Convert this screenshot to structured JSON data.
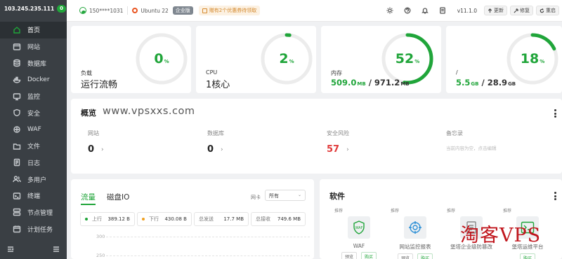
{
  "sidebar": {
    "ip": "103.245.235.111",
    "badge": "0",
    "items": [
      {
        "label": "首页",
        "icon": "home-icon"
      },
      {
        "label": "网站",
        "icon": "website-icon"
      },
      {
        "label": "数据库",
        "icon": "database-icon"
      },
      {
        "label": "Docker",
        "icon": "docker-icon"
      },
      {
        "label": "监控",
        "icon": "monitor-icon"
      },
      {
        "label": "安全",
        "icon": "shield-icon"
      },
      {
        "label": "WAF",
        "icon": "waf-icon"
      },
      {
        "label": "文件",
        "icon": "folder-icon"
      },
      {
        "label": "日志",
        "icon": "log-icon"
      },
      {
        "label": "多用户",
        "icon": "users-icon"
      },
      {
        "label": "终端",
        "icon": "terminal-icon"
      },
      {
        "label": "节点管理",
        "icon": "node-icon"
      },
      {
        "label": "计划任务",
        "icon": "calendar-icon"
      }
    ]
  },
  "topbar": {
    "user": "150****1031",
    "os": "Ubuntu 22",
    "edition": "企业版",
    "promo": "赠有2个优惠券待领取",
    "version": "v11.1.0",
    "update_label": "更新",
    "repair_label": "修复",
    "restart_label": "重启"
  },
  "stats": {
    "load": {
      "percent": "0",
      "unit": "%",
      "label": "负载",
      "status": "运行流畅",
      "fraction": 0.0
    },
    "cpu": {
      "percent": "2",
      "unit": "%",
      "label": "CPU",
      "cores": "1核心",
      "fraction": 0.02
    },
    "memory": {
      "percent": "52",
      "unit": "%",
      "label": "内存",
      "used": "509.0",
      "used_unit": "MB",
      "sep": " / ",
      "total": "971.2",
      "total_unit": "MB",
      "fraction": 0.52
    },
    "disk": {
      "percent": "18",
      "unit": "%",
      "label": "/",
      "used": "5.5",
      "used_unit": "GB",
      "sep": " / ",
      "total": "28.9",
      "total_unit": "GB",
      "fraction": 0.18
    }
  },
  "overview": {
    "title": "概览",
    "watermark": "www.vpsxxs.com",
    "items": [
      {
        "label": "网站",
        "value": "0"
      },
      {
        "label": "数据库",
        "value": "0"
      },
      {
        "label": "安全风险",
        "value": "57"
      },
      {
        "label": "备忘录",
        "value": "当前内容为空，点击编辑"
      }
    ]
  },
  "traffic": {
    "tabs": [
      "流量",
      "磁盘IO"
    ],
    "nic_label": "网卡",
    "nic_value": "所有",
    "stats": [
      {
        "label": "上行",
        "value": "389.12 B",
        "color": "#20a53a"
      },
      {
        "label": "下行",
        "value": "430.08 B",
        "color": "#f0a020"
      },
      {
        "label": "总发送",
        "value": "17.7 MB"
      },
      {
        "label": "总接收",
        "value": "749.6 MB"
      }
    ],
    "axis": [
      "300",
      "250"
    ]
  },
  "software": {
    "title": "软件",
    "items": [
      {
        "tag": "推荐",
        "name": "WAF",
        "btn1": "预览",
        "btn2": "购买"
      },
      {
        "tag": "推荐",
        "name": "网站监控报表",
        "btn1": "预览",
        "btn2": "购买"
      },
      {
        "tag": "推荐",
        "name": "堡塔企业级防篡改",
        "btn1": "",
        "btn2": ""
      },
      {
        "tag": "推荐",
        "name": "堡塔运维平台",
        "btn1": "",
        "btn2": "购买"
      }
    ]
  },
  "brand_watermark": "淘客VPS",
  "colors": {
    "accent": "#20a53a",
    "danger": "#e03a3a",
    "sidebar": "#3a3f44"
  }
}
